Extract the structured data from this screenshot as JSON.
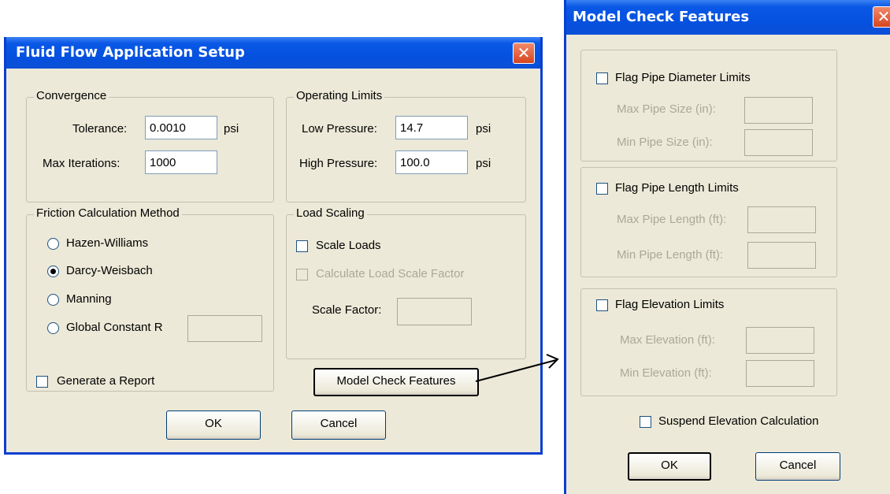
{
  "setup": {
    "title": "Fluid Flow Application Setup",
    "close": "✕",
    "convergence": {
      "legend": "Convergence",
      "tolerance_label": "Tolerance:",
      "tolerance_value": "0.0010",
      "tolerance_unit": "psi",
      "max_iterations_label": "Max Iterations:",
      "max_iterations_value": "1000"
    },
    "operating_limits": {
      "legend": "Operating Limits",
      "low_pressure_label": "Low Pressure:",
      "low_pressure_value": "14.7",
      "low_pressure_unit": "psi",
      "high_pressure_label": "High Pressure:",
      "high_pressure_value": "100.0",
      "high_pressure_unit": "psi"
    },
    "friction": {
      "legend": "Friction Calculation Method",
      "options": [
        "Hazen-Williams",
        "Darcy-Weisbach",
        "Manning",
        "Global Constant R"
      ],
      "selected": "Darcy-Weisbach",
      "global_constant_value": ""
    },
    "load_scaling": {
      "legend": "Load Scaling",
      "scale_loads_label": "Scale Loads",
      "scale_loads_checked": false,
      "calc_factor_label": "Calculate Load Scale Factor",
      "calc_factor_checked": false,
      "scale_factor_label": "Scale Factor:",
      "scale_factor_value": ""
    },
    "generate_report_label": "Generate a Report",
    "generate_report_checked": false,
    "model_check_button": "Model Check Features",
    "ok": "OK",
    "cancel": "Cancel"
  },
  "model_check": {
    "title": "Model Check Features",
    "close": "✕",
    "diameter": {
      "flag_label": "Flag Pipe Diameter Limits",
      "checked": false,
      "max_label": "Max Pipe Size (in):",
      "max_value": "",
      "min_label": "Min Pipe Size (in):",
      "min_value": ""
    },
    "length": {
      "flag_label": "Flag Pipe Length Limits",
      "checked": false,
      "max_label": "Max Pipe Length (ft):",
      "max_value": "",
      "min_label": "Min Pipe Length (ft):",
      "min_value": ""
    },
    "elevation": {
      "flag_label": "Flag Elevation Limits",
      "checked": false,
      "max_label": "Max Elevation (ft):",
      "max_value": "",
      "min_label": "Min Elevation (ft):",
      "min_value": ""
    },
    "suspend_label": "Suspend Elevation Calculation",
    "suspend_checked": false,
    "ok": "OK",
    "cancel": "Cancel"
  },
  "colors": {
    "titlebar": "#0551e0",
    "dialog_bg": "#ece9d8",
    "close_button": "#d6451f",
    "disabled_text": "#aca899"
  }
}
